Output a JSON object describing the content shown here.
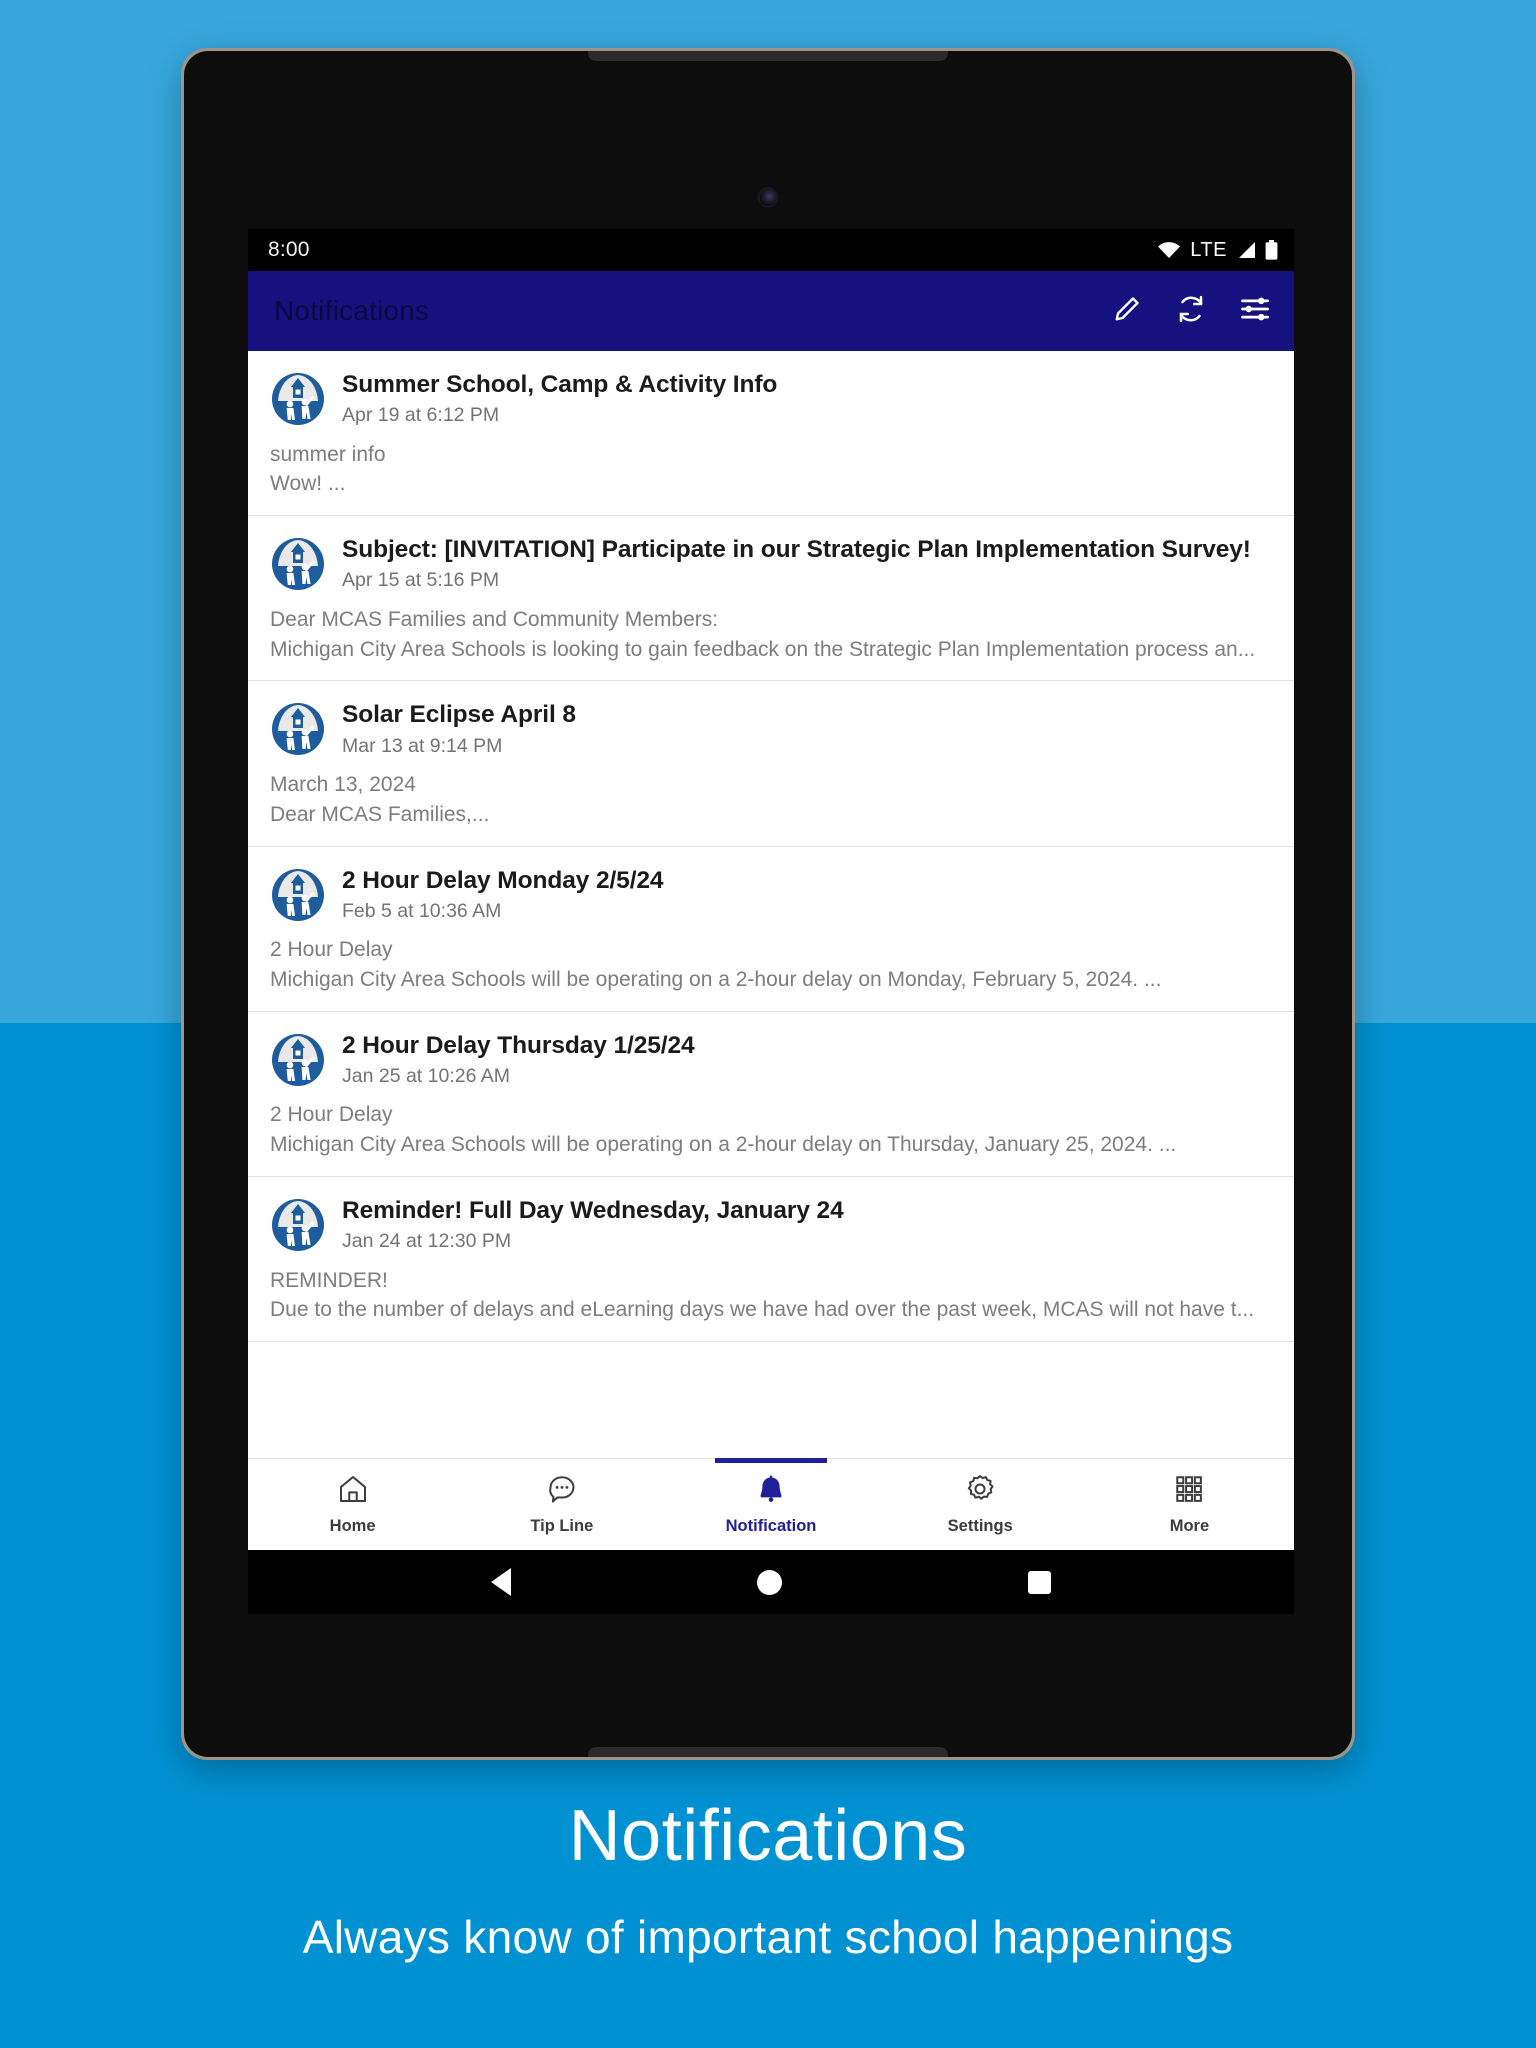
{
  "theme": {
    "bg_top": "#37a7dc",
    "bg_bottom": "#0091d2",
    "appbar_bg": "#15127f",
    "accent": "#21209b"
  },
  "statusbar": {
    "clock": "8:00",
    "network_label": "LTE",
    "icons": [
      "wifi-icon",
      "signal-icon",
      "battery-icon"
    ]
  },
  "appbar": {
    "title": "Notifications",
    "actions": [
      {
        "name": "compose-icon",
        "label": "Compose"
      },
      {
        "name": "refresh-icon",
        "label": "Refresh"
      },
      {
        "name": "filter-icon",
        "label": "Filter"
      }
    ]
  },
  "notifications": [
    {
      "title": "Summer School, Camp & Activity Info",
      "time": "Apr 19 at 6:12 PM",
      "line1": "summer info",
      "line2": "Wow! ..."
    },
    {
      "title": "Subject:  [INVITATION] Participate in our Strategic Plan Implementation Survey!",
      "time": "Apr 15 at 5:16 PM",
      "line1": "Dear MCAS Families and Community Members:",
      "line2": "Michigan City Area Schools is looking to gain feedback on the Strategic Plan Implementation process an..."
    },
    {
      "title": "Solar Eclipse April 8",
      "time": "Mar 13 at 9:14 PM",
      "line1": "March 13, 2024",
      "line2": "Dear MCAS Families,..."
    },
    {
      "title": "2 Hour Delay Monday 2/5/24",
      "time": "Feb 5 at 10:36 AM",
      "line1": "2 Hour Delay",
      "line2": "Michigan City Area Schools will be operating on a 2-hour delay on Monday, February 5, 2024. ..."
    },
    {
      "title": "2 Hour Delay Thursday 1/25/24",
      "time": "Jan 25 at 10:26 AM",
      "line1": "2 Hour Delay",
      "line2": "Michigan City Area Schools will be operating on a 2-hour delay on Thursday, January 25, 2024. ..."
    },
    {
      "title": "Reminder! Full Day Wednesday, January 24",
      "time": "Jan 24 at 12:30 PM",
      "line1": "REMINDER!",
      "line2": "Due to the number of delays and eLearning days we have had over the past week, MCAS will not have t..."
    }
  ],
  "tabs": [
    {
      "label": "Home",
      "icon": "home-icon",
      "active": false
    },
    {
      "label": "Tip Line",
      "icon": "chat-bubble-icon",
      "active": false
    },
    {
      "label": "Notification",
      "icon": "bell-icon",
      "active": true
    },
    {
      "label": "Settings",
      "icon": "gear-icon",
      "active": false
    },
    {
      "label": "More",
      "icon": "grid-dots-icon",
      "active": false
    }
  ],
  "navbar": {
    "back": "back-button",
    "home": "home-button",
    "recent": "recents-button"
  },
  "caption": {
    "headline": "Notifications",
    "subhead": "Always know of important school happenings"
  }
}
